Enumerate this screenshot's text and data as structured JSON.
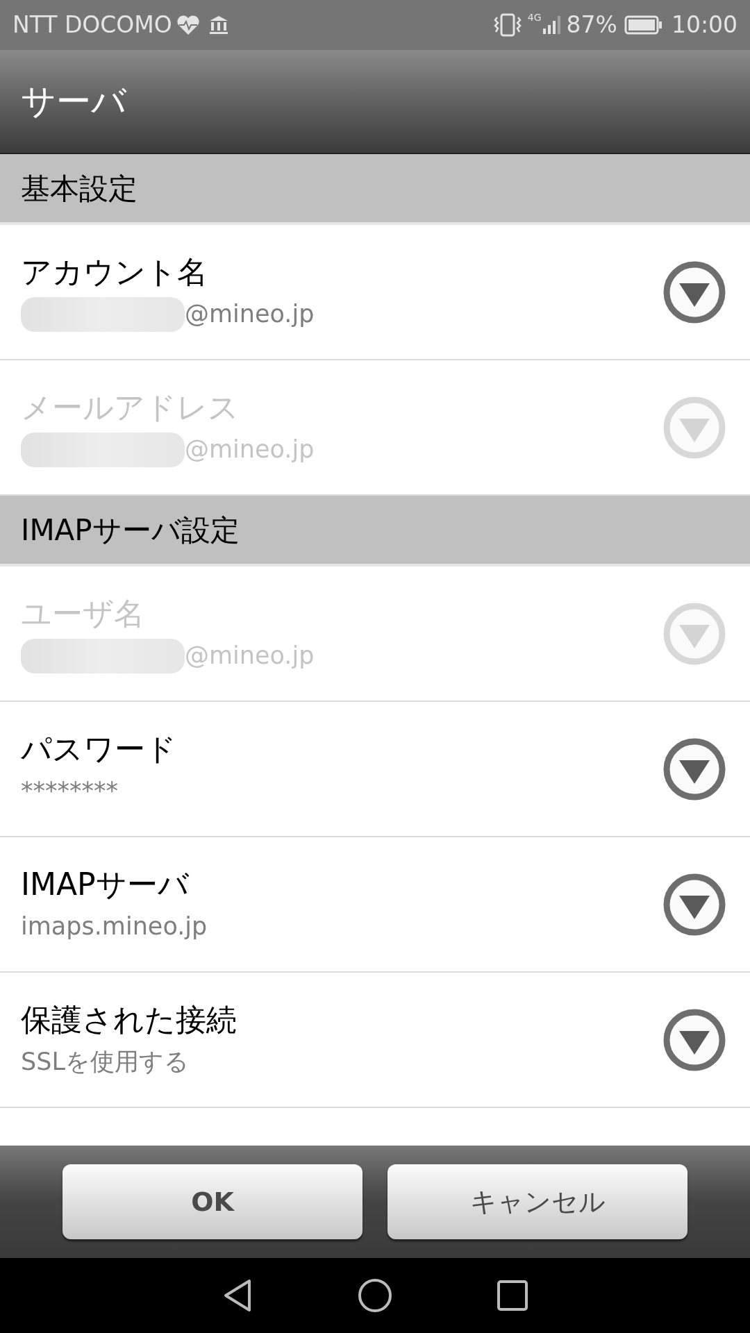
{
  "status_bar": {
    "carrier": "NTT DOCOMO",
    "network": "4G",
    "battery": "87%",
    "time": "10:00"
  },
  "title": "サーバ",
  "sections": [
    {
      "header": "基本設定",
      "rows": [
        {
          "label": "アカウント名",
          "value": "@mineo.jp",
          "redacted": true,
          "disabled": false
        },
        {
          "label": "メールアドレス",
          "value": "@mineo.jp",
          "redacted": true,
          "disabled": true
        }
      ]
    },
    {
      "header": "IMAPサーバ設定",
      "rows": [
        {
          "label": "ユーザ名",
          "value": "@mineo.jp",
          "redacted": true,
          "disabled": true
        },
        {
          "label": "パスワード",
          "value": "********",
          "redacted": false,
          "disabled": false
        },
        {
          "label": "IMAPサーバ",
          "value": "imaps.mineo.jp",
          "redacted": false,
          "disabled": false
        },
        {
          "label": "保護された接続",
          "value": "SSLを使用する",
          "redacted": false,
          "disabled": false
        }
      ]
    }
  ],
  "buttons": [
    "OK",
    "キャンセル"
  ]
}
